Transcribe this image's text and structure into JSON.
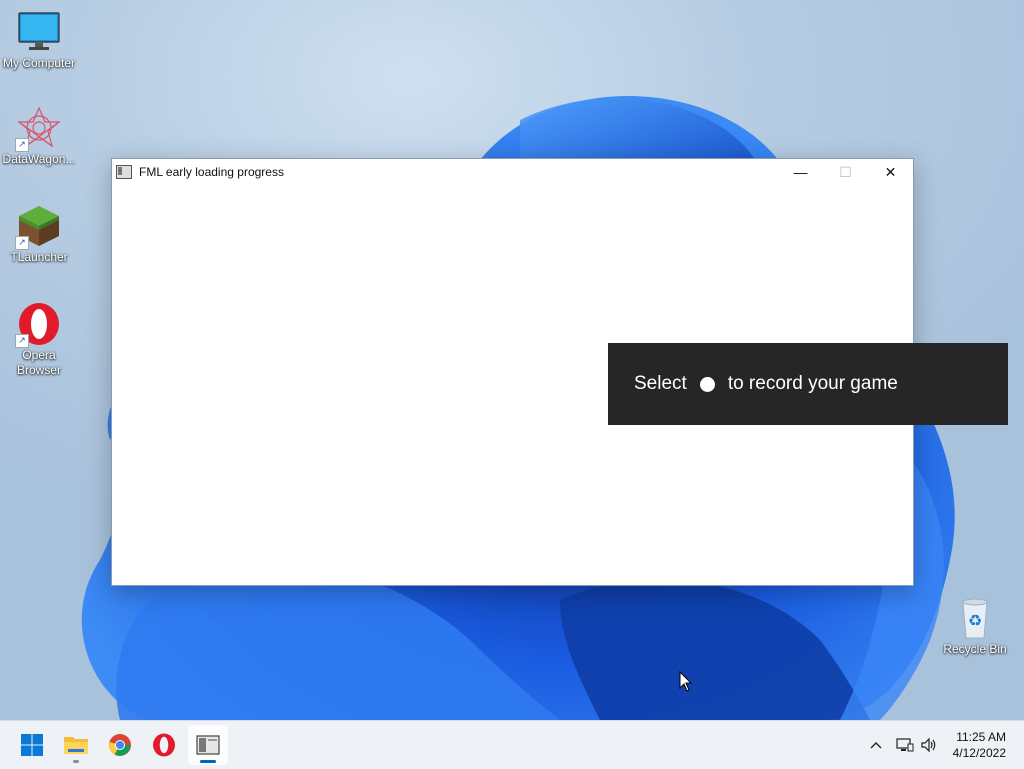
{
  "desktop": {
    "icons": [
      {
        "label": "My Computer",
        "icon": "monitor-icon"
      },
      {
        "label": "DataWagon...",
        "icon": "datawagon-icon"
      },
      {
        "label": "TLauncher",
        "icon": "minecraft-grass-block-icon"
      },
      {
        "label": "Opera Browser",
        "icon": "opera-icon"
      }
    ],
    "recycle_bin": {
      "label": "Recycle Bin",
      "icon": "recycle-bin-icon"
    }
  },
  "window": {
    "title": "FML early loading progress",
    "controls": {
      "minimize": "—",
      "maximize": "☐",
      "close": "✕"
    }
  },
  "toast": {
    "prefix": "Select",
    "suffix": "to record your game"
  },
  "taskbar": {
    "apps": [
      {
        "name": "Start",
        "icon": "windows-start-icon"
      },
      {
        "name": "File Explorer",
        "icon": "folder-icon"
      },
      {
        "name": "Google Chrome",
        "icon": "chrome-icon"
      },
      {
        "name": "Opera",
        "icon": "opera-icon"
      },
      {
        "name": "FML early loading progress",
        "icon": "window-app-icon",
        "active": true
      }
    ],
    "tray": {
      "time": "11:25 AM",
      "date": "4/12/2022"
    }
  },
  "colors": {
    "accent": "#0067c0",
    "toast_bg": "#262626",
    "taskbar_bg": "#eef1f5"
  }
}
